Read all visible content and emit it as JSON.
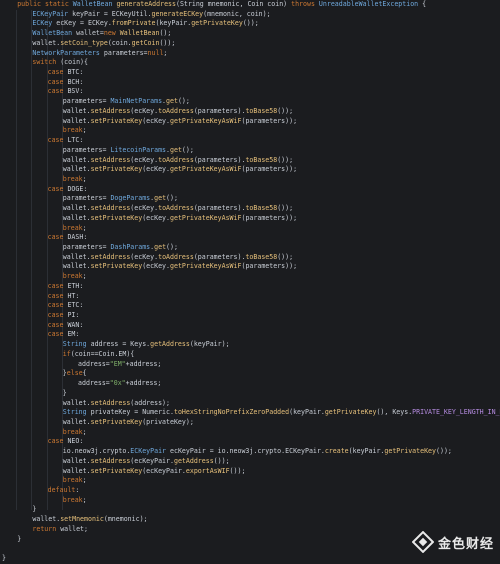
{
  "editor": {
    "language": "java",
    "colors": {
      "background": "#1b1c1f",
      "keyword": "#cc7832",
      "type": "#6fa8dc",
      "method": "#e6c07b",
      "string": "#7fb069",
      "constant": "#b58be0",
      "text": "#c9ced6"
    },
    "lines": [
      {
        "indent": 1,
        "tokens": [
          [
            "kw",
            "public static "
          ],
          [
            "ty",
            "WalletBean "
          ],
          [
            "fn",
            "generateAddress"
          ],
          [
            "pl",
            "(String mnemonic, Coin coin) "
          ],
          [
            "kw",
            "throws "
          ],
          [
            "ty",
            "UnreadableWalletException"
          ],
          [
            "pl",
            " {"
          ]
        ]
      },
      {
        "indent": 2,
        "tokens": [
          [
            "ty",
            "ECKeyPair "
          ],
          [
            "pl",
            "keyPair = ECKeyUtil."
          ],
          [
            "fn",
            "generateECKey"
          ],
          [
            "pl",
            "(mnemonic, coin);"
          ]
        ]
      },
      {
        "indent": 2,
        "tokens": [
          [
            "ty",
            "ECKey "
          ],
          [
            "pl",
            "ecKey = ECKey."
          ],
          [
            "fn",
            "fromPrivate"
          ],
          [
            "pl",
            "(keyPair."
          ],
          [
            "fn",
            "getPrivateKey"
          ],
          [
            "pl",
            "());"
          ]
        ]
      },
      {
        "indent": 2,
        "tokens": [
          [
            "ty",
            "WalletBean "
          ],
          [
            "pl",
            "wallet="
          ],
          [
            "kw",
            "new "
          ],
          [
            "fn",
            "WalletBean"
          ],
          [
            "pl",
            "();"
          ]
        ]
      },
      {
        "indent": 2,
        "tokens": [
          [
            "pl",
            "wallet."
          ],
          [
            "fn",
            "setCoin_type"
          ],
          [
            "pl",
            "(coin."
          ],
          [
            "fn",
            "getCoin"
          ],
          [
            "pl",
            "());"
          ]
        ]
      },
      {
        "indent": 2,
        "tokens": [
          [
            "ty",
            "NetworkParameters "
          ],
          [
            "pl",
            "parameters="
          ],
          [
            "kw",
            "null"
          ],
          [
            "pl",
            ";"
          ]
        ]
      },
      {
        "indent": 2,
        "tokens": [
          [
            "kw",
            "switch "
          ],
          [
            "pl",
            "(coin){"
          ]
        ]
      },
      {
        "indent": 3,
        "tokens": [
          [
            "kw",
            "case "
          ],
          [
            "pl",
            "BTC:"
          ]
        ]
      },
      {
        "indent": 3,
        "tokens": [
          [
            "kw",
            "case "
          ],
          [
            "pl",
            "BCH:"
          ]
        ]
      },
      {
        "indent": 3,
        "tokens": [
          [
            "kw",
            "case "
          ],
          [
            "pl",
            "BSV:"
          ]
        ]
      },
      {
        "indent": 4,
        "tokens": [
          [
            "pl",
            "parameters= "
          ],
          [
            "ty",
            "MainNetParams"
          ],
          [
            "pl",
            "."
          ],
          [
            "fn",
            "get"
          ],
          [
            "pl",
            "();"
          ]
        ]
      },
      {
        "indent": 4,
        "tokens": [
          [
            "pl",
            "wallet."
          ],
          [
            "fn",
            "setAddress"
          ],
          [
            "pl",
            "(ecKey."
          ],
          [
            "fn",
            "toAddress"
          ],
          [
            "pl",
            "(parameters)."
          ],
          [
            "fn",
            "toBase58"
          ],
          [
            "pl",
            "());"
          ]
        ]
      },
      {
        "indent": 4,
        "tokens": [
          [
            "pl",
            "wallet."
          ],
          [
            "fn",
            "setPrivateKey"
          ],
          [
            "pl",
            "(ecKey."
          ],
          [
            "fn",
            "getPrivateKeyAsWiF"
          ],
          [
            "pl",
            "(parameters));"
          ]
        ]
      },
      {
        "indent": 4,
        "tokens": [
          [
            "kw",
            "break"
          ],
          [
            "pl",
            ";"
          ]
        ]
      },
      {
        "indent": 3,
        "tokens": [
          [
            "kw",
            "case "
          ],
          [
            "pl",
            "LTC:"
          ]
        ]
      },
      {
        "indent": 4,
        "tokens": [
          [
            "pl",
            "parameters= "
          ],
          [
            "ty",
            "LitecoinParams"
          ],
          [
            "pl",
            "."
          ],
          [
            "fn",
            "get"
          ],
          [
            "pl",
            "();"
          ]
        ]
      },
      {
        "indent": 4,
        "tokens": [
          [
            "pl",
            "wallet."
          ],
          [
            "fn",
            "setAddress"
          ],
          [
            "pl",
            "(ecKey."
          ],
          [
            "fn",
            "toAddress"
          ],
          [
            "pl",
            "(parameters)."
          ],
          [
            "fn",
            "toBase58"
          ],
          [
            "pl",
            "());"
          ]
        ]
      },
      {
        "indent": 4,
        "tokens": [
          [
            "pl",
            "wallet."
          ],
          [
            "fn",
            "setPrivateKey"
          ],
          [
            "pl",
            "(ecKey."
          ],
          [
            "fn",
            "getPrivateKeyAsWiF"
          ],
          [
            "pl",
            "(parameters));"
          ]
        ]
      },
      {
        "indent": 4,
        "tokens": [
          [
            "kw",
            "break"
          ],
          [
            "pl",
            ";"
          ]
        ]
      },
      {
        "indent": 3,
        "tokens": [
          [
            "kw",
            "case "
          ],
          [
            "pl",
            "DOGE:"
          ]
        ]
      },
      {
        "indent": 4,
        "tokens": [
          [
            "pl",
            "parameters= "
          ],
          [
            "ty",
            "DogeParams"
          ],
          [
            "pl",
            "."
          ],
          [
            "fn",
            "get"
          ],
          [
            "pl",
            "();"
          ]
        ]
      },
      {
        "indent": 4,
        "tokens": [
          [
            "pl",
            "wallet."
          ],
          [
            "fn",
            "setAddress"
          ],
          [
            "pl",
            "(ecKey."
          ],
          [
            "fn",
            "toAddress"
          ],
          [
            "pl",
            "(parameters)."
          ],
          [
            "fn",
            "toBase58"
          ],
          [
            "pl",
            "());"
          ]
        ]
      },
      {
        "indent": 4,
        "tokens": [
          [
            "pl",
            "wallet."
          ],
          [
            "fn",
            "setPrivateKey"
          ],
          [
            "pl",
            "(ecKey."
          ],
          [
            "fn",
            "getPrivateKeyAsWiF"
          ],
          [
            "pl",
            "(parameters));"
          ]
        ]
      },
      {
        "indent": 4,
        "tokens": [
          [
            "kw",
            "break"
          ],
          [
            "pl",
            ";"
          ]
        ]
      },
      {
        "indent": 3,
        "tokens": [
          [
            "kw",
            "case "
          ],
          [
            "pl",
            "DASH:"
          ]
        ]
      },
      {
        "indent": 4,
        "tokens": [
          [
            "pl",
            "parameters= "
          ],
          [
            "ty",
            "DashParams"
          ],
          [
            "pl",
            "."
          ],
          [
            "fn",
            "get"
          ],
          [
            "pl",
            "();"
          ]
        ]
      },
      {
        "indent": 4,
        "tokens": [
          [
            "pl",
            "wallet."
          ],
          [
            "fn",
            "setAddress"
          ],
          [
            "pl",
            "(ecKey."
          ],
          [
            "fn",
            "toAddress"
          ],
          [
            "pl",
            "(parameters)."
          ],
          [
            "fn",
            "toBase58"
          ],
          [
            "pl",
            "());"
          ]
        ]
      },
      {
        "indent": 4,
        "tokens": [
          [
            "pl",
            "wallet."
          ],
          [
            "fn",
            "setPrivateKey"
          ],
          [
            "pl",
            "(ecKey."
          ],
          [
            "fn",
            "getPrivateKeyAsWiF"
          ],
          [
            "pl",
            "(parameters));"
          ]
        ]
      },
      {
        "indent": 4,
        "tokens": [
          [
            "kw",
            "break"
          ],
          [
            "pl",
            ";"
          ]
        ]
      },
      {
        "indent": 3,
        "tokens": [
          [
            "kw",
            "case "
          ],
          [
            "pl",
            "ETH:"
          ]
        ]
      },
      {
        "indent": 3,
        "tokens": [
          [
            "kw",
            "case "
          ],
          [
            "pl",
            "HT:"
          ]
        ]
      },
      {
        "indent": 3,
        "tokens": [
          [
            "kw",
            "case "
          ],
          [
            "pl",
            "ETC:"
          ]
        ]
      },
      {
        "indent": 3,
        "tokens": [
          [
            "kw",
            "case "
          ],
          [
            "pl",
            "PI:"
          ]
        ]
      },
      {
        "indent": 3,
        "tokens": [
          [
            "kw",
            "case "
          ],
          [
            "pl",
            "WAN:"
          ]
        ]
      },
      {
        "indent": 3,
        "tokens": [
          [
            "kw",
            "case "
          ],
          [
            "pl",
            "EM:"
          ]
        ]
      },
      {
        "indent": 4,
        "tokens": [
          [
            "ty",
            "String "
          ],
          [
            "pl",
            "address = Keys."
          ],
          [
            "fn",
            "getAddress"
          ],
          [
            "pl",
            "(keyPair);"
          ]
        ]
      },
      {
        "indent": 4,
        "tokens": [
          [
            "kw",
            "if"
          ],
          [
            "pl",
            "(coin==Coin.EM){"
          ]
        ]
      },
      {
        "indent": 5,
        "tokens": [
          [
            "pl",
            "address="
          ],
          [
            "st",
            "\"EM\""
          ],
          [
            "pl",
            "+address;"
          ]
        ]
      },
      {
        "indent": 4,
        "tokens": [
          [
            "pl",
            "}"
          ],
          [
            "kw",
            "else"
          ],
          [
            "pl",
            "{"
          ]
        ]
      },
      {
        "indent": 5,
        "tokens": [
          [
            "pl",
            "address="
          ],
          [
            "st",
            "\"0x\""
          ],
          [
            "pl",
            "+address;"
          ]
        ]
      },
      {
        "indent": 4,
        "tokens": [
          [
            "pl",
            "}"
          ]
        ]
      },
      {
        "indent": 4,
        "tokens": [
          [
            "pl",
            "wallet."
          ],
          [
            "fn",
            "setAddress"
          ],
          [
            "pl",
            "(address);"
          ]
        ]
      },
      {
        "indent": 4,
        "tokens": [
          [
            "ty",
            "String "
          ],
          [
            "pl",
            "privateKey = Numeric."
          ],
          [
            "fn",
            "toHexStringNoPrefixZeroPadded"
          ],
          [
            "pl",
            "(keyPair."
          ],
          [
            "fn",
            "getPrivateKey"
          ],
          [
            "pl",
            "(), Keys."
          ],
          [
            "cn",
            "PRIVATE_KEY_LENGTH_IN_HEX"
          ],
          [
            "pl",
            ");"
          ]
        ]
      },
      {
        "indent": 4,
        "tokens": [
          [
            "pl",
            "wallet."
          ],
          [
            "fn",
            "setPrivateKey"
          ],
          [
            "pl",
            "(privateKey);"
          ]
        ]
      },
      {
        "indent": 4,
        "tokens": [
          [
            "kw",
            "break"
          ],
          [
            "pl",
            ";"
          ]
        ]
      },
      {
        "indent": 3,
        "tokens": [
          [
            "kw",
            "case "
          ],
          [
            "pl",
            "NEO:"
          ]
        ]
      },
      {
        "indent": 4,
        "tokens": [
          [
            "pl",
            "io.neow3j.crypto."
          ],
          [
            "ty",
            "ECKeyPair "
          ],
          [
            "pl",
            "ecKeyPair = io.neow3j.crypto.ECKeyPair."
          ],
          [
            "fn",
            "create"
          ],
          [
            "pl",
            "(keyPair."
          ],
          [
            "fn",
            "getPrivateKey"
          ],
          [
            "pl",
            "());"
          ]
        ]
      },
      {
        "indent": 4,
        "tokens": [
          [
            "pl",
            "wallet."
          ],
          [
            "fn",
            "setAddress"
          ],
          [
            "pl",
            "(ecKeyPair."
          ],
          [
            "fn",
            "getAddress"
          ],
          [
            "pl",
            "());"
          ]
        ]
      },
      {
        "indent": 4,
        "tokens": [
          [
            "pl",
            "wallet."
          ],
          [
            "fn",
            "setPrivateKey"
          ],
          [
            "pl",
            "(ecKeyPair."
          ],
          [
            "fn",
            "exportAsWIF"
          ],
          [
            "pl",
            "());"
          ]
        ]
      },
      {
        "indent": 4,
        "tokens": [
          [
            "kw",
            "break"
          ],
          [
            "pl",
            ";"
          ]
        ]
      },
      {
        "indent": 3,
        "tokens": [
          [
            "kw",
            "default"
          ],
          [
            "pl",
            ":"
          ]
        ]
      },
      {
        "indent": 4,
        "tokens": [
          [
            "kw",
            "break"
          ],
          [
            "pl",
            ";"
          ]
        ]
      },
      {
        "indent": 2,
        "tokens": [
          [
            "pl",
            "}"
          ]
        ]
      },
      {
        "indent": 2,
        "tokens": [
          [
            "pl",
            "wallet."
          ],
          [
            "fn",
            "setMnemonic"
          ],
          [
            "pl",
            "(mnemonic);"
          ]
        ]
      },
      {
        "indent": 2,
        "tokens": [
          [
            "kw",
            "return "
          ],
          [
            "pl",
            "wallet;"
          ]
        ]
      },
      {
        "indent": 1,
        "tokens": [
          [
            "pl",
            "}"
          ]
        ]
      },
      {
        "indent": 0,
        "tokens": []
      },
      {
        "indent": 0,
        "tokens": [
          [
            "pl",
            "}"
          ]
        ]
      }
    ]
  },
  "watermark": {
    "text": "金色财经",
    "logo_icon": "diamond-logo-icon",
    "logo_color": "#e9e9e9"
  }
}
